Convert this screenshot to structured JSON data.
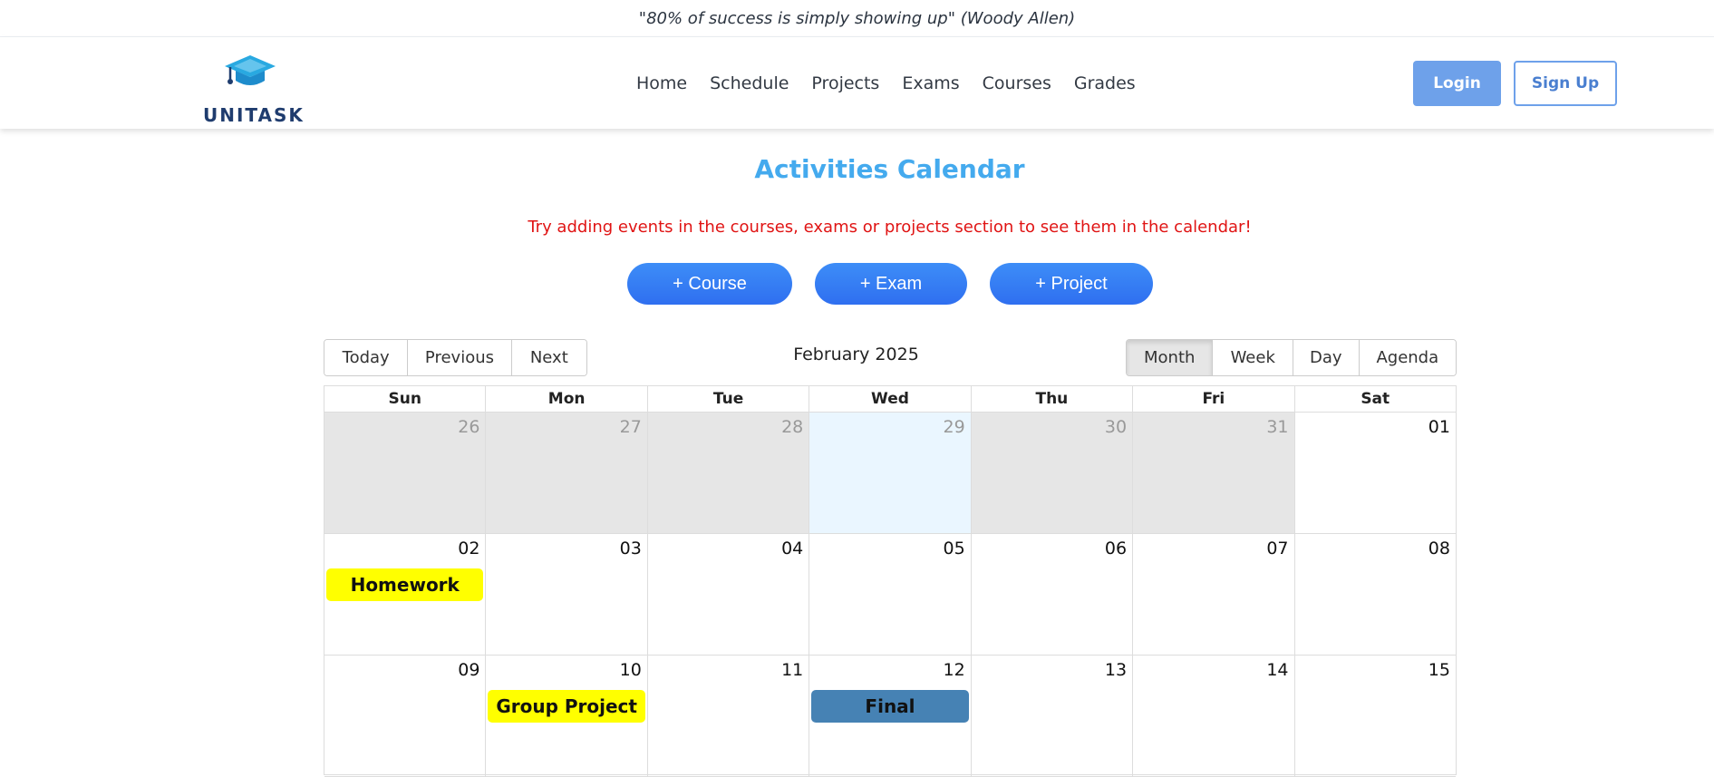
{
  "quote": "\"80% of success is simply showing up\" (Woody Allen)",
  "brand": {
    "name": "UNITASK",
    "icon": "graduation-cap-icon",
    "color": "#1f3c6e",
    "icon_color": "#29a9e1"
  },
  "nav": [
    {
      "label": "Home"
    },
    {
      "label": "Schedule"
    },
    {
      "label": "Projects"
    },
    {
      "label": "Exams"
    },
    {
      "label": "Courses"
    },
    {
      "label": "Grades"
    }
  ],
  "auth": {
    "login": "Login",
    "signup": "Sign Up"
  },
  "main": {
    "title": "Activities Calendar",
    "hint": "Try adding events in the courses, exams or projects section to see them in the calendar!",
    "add_buttons": [
      {
        "label": "+ Course"
      },
      {
        "label": "+ Exam"
      },
      {
        "label": "+ Project"
      }
    ]
  },
  "calendar": {
    "nav_buttons": [
      {
        "label": "Today"
      },
      {
        "label": "Previous"
      },
      {
        "label": "Next"
      }
    ],
    "month_label": "February 2025",
    "view_buttons": [
      {
        "label": "Month",
        "active": true
      },
      {
        "label": "Week"
      },
      {
        "label": "Day"
      },
      {
        "label": "Agenda"
      }
    ],
    "weekdays": [
      "Sun",
      "Mon",
      "Tue",
      "Wed",
      "Thu",
      "Fri",
      "Sat"
    ],
    "weeks": [
      [
        {
          "d": "26",
          "off": true
        },
        {
          "d": "27",
          "off": true
        },
        {
          "d": "28",
          "off": true
        },
        {
          "d": "29",
          "off": true,
          "today": true
        },
        {
          "d": "30",
          "off": true
        },
        {
          "d": "31",
          "off": true
        },
        {
          "d": "01"
        }
      ],
      [
        {
          "d": "02",
          "event": "Homework",
          "color": "#ffff00"
        },
        {
          "d": "03"
        },
        {
          "d": "04"
        },
        {
          "d": "05"
        },
        {
          "d": "06"
        },
        {
          "d": "07"
        },
        {
          "d": "08"
        }
      ],
      [
        {
          "d": "09"
        },
        {
          "d": "10",
          "event": "Group Project",
          "color": "#ffff00"
        },
        {
          "d": "11"
        },
        {
          "d": "12",
          "event": "Final",
          "color": "#4682b4"
        },
        {
          "d": "13"
        },
        {
          "d": "14"
        },
        {
          "d": "15"
        }
      ]
    ]
  },
  "colors": {
    "accent": "#44aaee",
    "hint": "#e01414",
    "button_blue": "#3d8df7",
    "login_bg": "#6ea1ea"
  }
}
